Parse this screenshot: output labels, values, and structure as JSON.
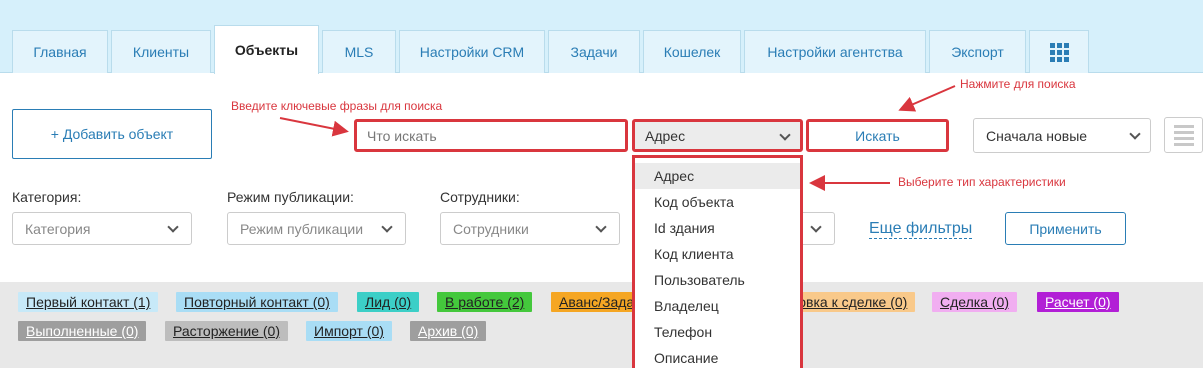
{
  "tabs": [
    {
      "label": "Главная"
    },
    {
      "label": "Клиенты"
    },
    {
      "label": "Объекты",
      "active": true
    },
    {
      "label": "MLS"
    },
    {
      "label": "Настройки CRM"
    },
    {
      "label": "Задачи"
    },
    {
      "label": "Кошелек"
    },
    {
      "label": "Настройки агентства"
    },
    {
      "label": "Экспорт"
    },
    {
      "icon": "grid-apps-icon"
    }
  ],
  "toolbar": {
    "add_label": "+ Добавить объект",
    "search_placeholder": "Что искать",
    "search_type_value": "Адрес",
    "search_button": "Искать",
    "sort_value": "Сначала новые",
    "list_view_icon": "list-view-icon"
  },
  "filters": {
    "category_label": "Категория:",
    "category_placeholder": "Категория",
    "publication_label": "Режим публикации:",
    "publication_placeholder": "Режим публикации",
    "staff_label": "Сотрудники:",
    "staff_placeholder": "Сотрудники",
    "more_filters": "Еще фильтры",
    "apply": "Применить"
  },
  "search_type_options": [
    "Адрес",
    "Код объекта",
    "Id здания",
    "Код клиента",
    "Пользователь",
    "Владелец",
    "Телефон",
    "Описание"
  ],
  "status_chips": [
    {
      "label": "Первый контакт (1)",
      "color": "#c7e9f8"
    },
    {
      "label": "Повторный контакт (0)",
      "color": "#a9ddf5"
    },
    {
      "label": "Лид (0)",
      "color": "#3ccfc7"
    },
    {
      "label": "В работе (2)",
      "color": "#44c83c"
    },
    {
      "label": "Аванс/Задаток (0)",
      "color": "#f5a623"
    },
    {
      "label": "Подготовка к сделке (0)",
      "color": "#f9c98a"
    },
    {
      "label": "Сделка (0)",
      "color": "#f1aef1"
    },
    {
      "label": "Расчет (0)",
      "color": "#b21fd6",
      "text_color": "#ffffff"
    },
    {
      "label": "Выполненные (0)",
      "color": "#9e9e9e",
      "text_color": "#ffffff"
    },
    {
      "label": "Расторжение (0)",
      "color": "#bdbdbd"
    },
    {
      "label": "Импорт (0)",
      "color": "#a9ddf5"
    },
    {
      "label": "Архив (0)",
      "color": "#9e9e9e",
      "text_color": "#ffffff"
    }
  ],
  "annotations": {
    "search_hint": "Введите ключевые фразы для поиска",
    "button_hint": "Нажмите для поиска",
    "type_hint": "Выберите тип характеристики"
  }
}
